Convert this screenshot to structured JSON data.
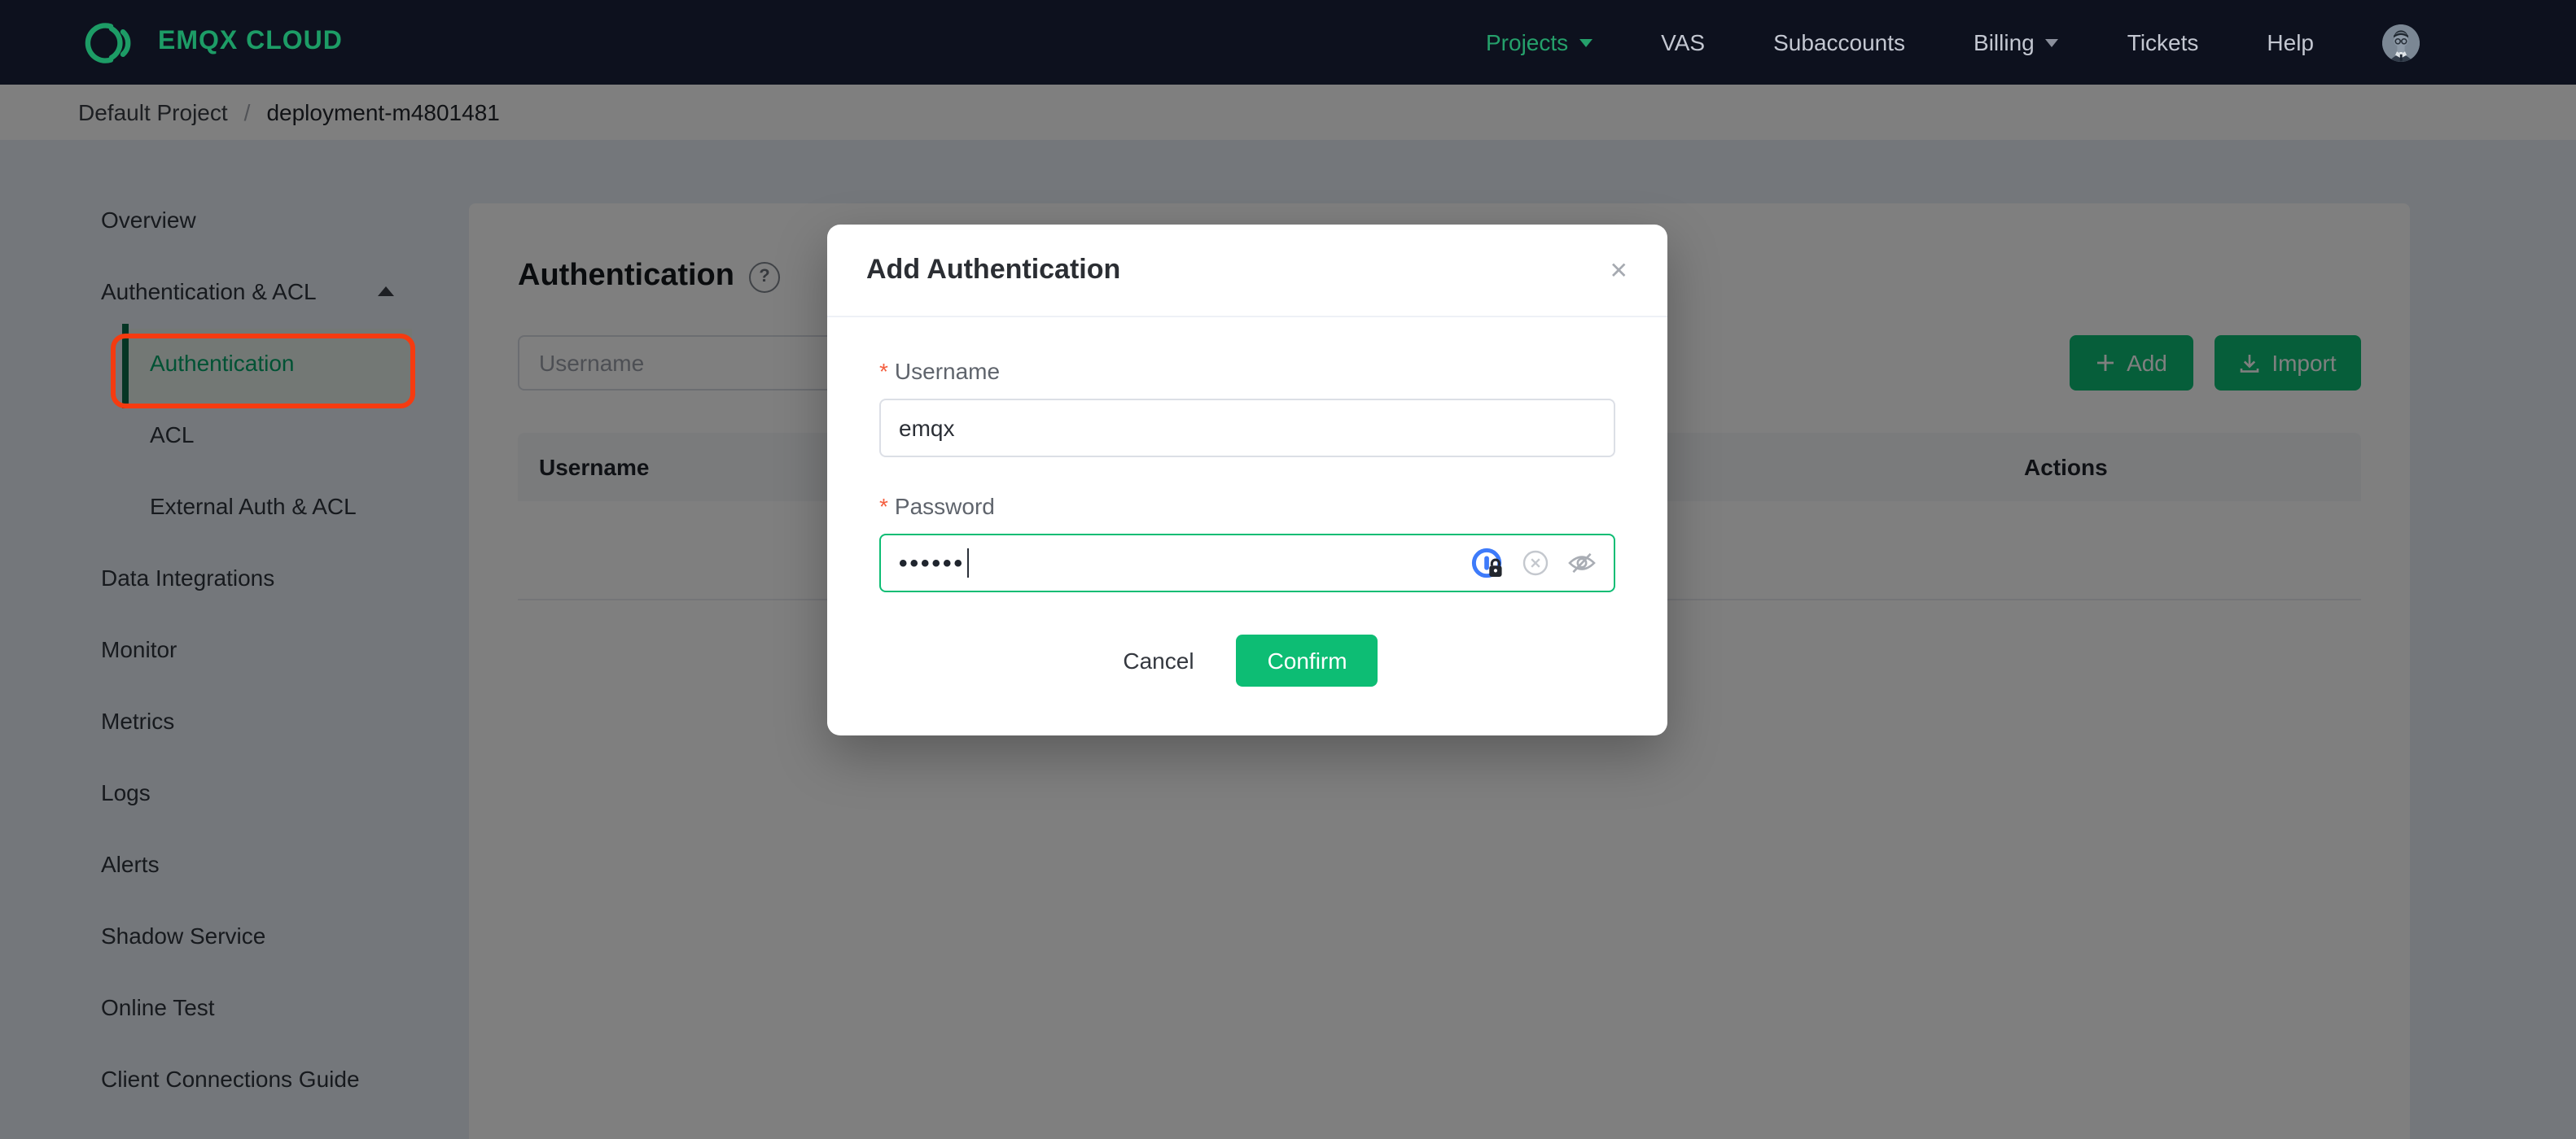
{
  "navbar": {
    "logo_text": "EMQX CLOUD",
    "items": [
      {
        "label": "Projects",
        "active": true,
        "caret": true
      },
      {
        "label": "VAS"
      },
      {
        "label": "Subaccounts"
      },
      {
        "label": "Billing",
        "caret": true
      },
      {
        "label": "Tickets"
      },
      {
        "label": "Help"
      }
    ]
  },
  "breadcrumb": {
    "project": "Default Project",
    "separator": "/",
    "deployment": "deployment-m4801481"
  },
  "sidebar": {
    "items": [
      {
        "label": "Overview"
      },
      {
        "label": "Authentication & ACL",
        "expanded": true
      },
      {
        "label": "Authentication",
        "active": true,
        "annotated": true
      },
      {
        "label": "ACL"
      },
      {
        "label": "External Auth & ACL"
      },
      {
        "label": "Data Integrations"
      },
      {
        "label": "Monitor"
      },
      {
        "label": "Metrics"
      },
      {
        "label": "Logs"
      },
      {
        "label": "Alerts"
      },
      {
        "label": "Shadow Service"
      },
      {
        "label": "Online Test"
      },
      {
        "label": "Client Connections Guide"
      }
    ]
  },
  "page": {
    "title": "Authentication",
    "help_glyph": "?",
    "search_placeholder": "Username",
    "add_label": "Add",
    "import_label": "Import",
    "table": {
      "columns": [
        "Username",
        "Actions"
      ]
    }
  },
  "modal": {
    "title": "Add Authentication",
    "close_glyph": "✕",
    "required_marker": "*",
    "username_label": "Username",
    "username_value": "emqx",
    "password_label": "Password",
    "password_masked": "••••••",
    "cancel_label": "Cancel",
    "confirm_label": "Confirm"
  },
  "colors": {
    "accent_green": "#0dbd74",
    "navbar_green": "#1d9c66",
    "annotation_red": "#f53b10",
    "onepassword_blue": "#3e7bfa"
  }
}
